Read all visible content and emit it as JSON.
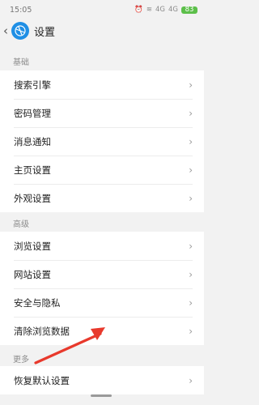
{
  "status_bar": {
    "time": "15:05",
    "signal_1": "4G",
    "signal_2": "4G",
    "battery": "83"
  },
  "header": {
    "back_icon": "chevron-left-icon",
    "app_icon": "browser-globe-icon",
    "title": "设置"
  },
  "sections": [
    {
      "label": "基础",
      "items": [
        "搜索引擎",
        "密码管理",
        "消息通知",
        "主页设置",
        "外观设置"
      ]
    },
    {
      "label": "高级",
      "items": [
        "浏览设置",
        "网站设置",
        "安全与隐私",
        "清除浏览数据"
      ]
    },
    {
      "label": "更多",
      "items": [
        "恢复默认设置"
      ]
    }
  ],
  "annotation": {
    "arrow_color": "#e8392c"
  },
  "colors": {
    "accent": "#1f8fe5",
    "background": "#f2f2f2"
  }
}
